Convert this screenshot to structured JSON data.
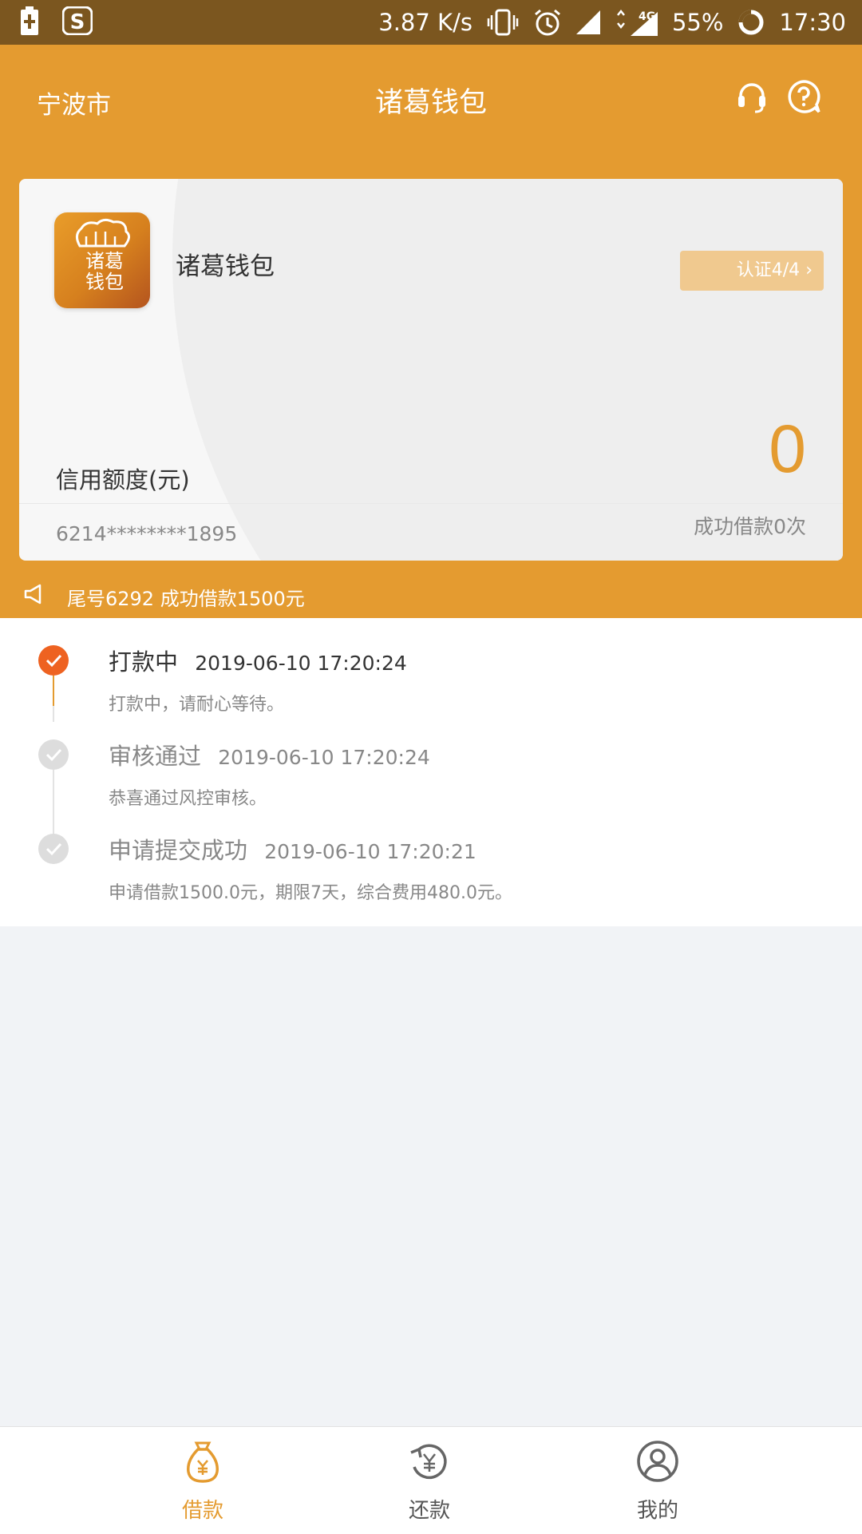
{
  "status_bar": {
    "speed": "3.87 K/s",
    "network": "4G",
    "battery": "55%",
    "time": "17:30",
    "icons": [
      "battery-charging-icon",
      "app-s-icon",
      "vibrate-icon",
      "alarm-icon",
      "signal-icon",
      "signal-4g-icon",
      "battery-ring-icon"
    ]
  },
  "header": {
    "city": "宁波市",
    "title": "诸葛钱包",
    "icons": [
      "headset-icon",
      "help-icon"
    ]
  },
  "card": {
    "logo_text": "诸葛钱包",
    "app_name": "诸葛钱包",
    "verify_label": "认证4/4",
    "credit_label": "信用额度(元)",
    "credit_value": "0",
    "card_number": "6214********1895",
    "success_count": "成功借款0次"
  },
  "notice": {
    "text": "尾号6292 成功借款1500元"
  },
  "timeline": [
    {
      "title": "打款中",
      "time": "2019-06-10 17:20:24",
      "desc": "打款中，请耐心等待。",
      "active": true
    },
    {
      "title": "审核通过",
      "time": "2019-06-10 17:20:24",
      "desc": "恭喜通过风控审核。",
      "active": false
    },
    {
      "title": "申请提交成功",
      "time": "2019-06-10 17:20:21",
      "desc": "申请借款1500.0元，期限7天，综合费用480.0元。",
      "active": false
    }
  ],
  "tabs": [
    {
      "label": "借款",
      "icon": "money-bag-icon",
      "active": true
    },
    {
      "label": "还款",
      "icon": "repay-icon",
      "active": false
    },
    {
      "label": "我的",
      "icon": "user-icon",
      "active": false
    }
  ],
  "colors": {
    "brand": "#e49b30",
    "status_bar": "#7b561f",
    "active_dot": "#ee6221",
    "inactive_dot": "#dddddd"
  }
}
